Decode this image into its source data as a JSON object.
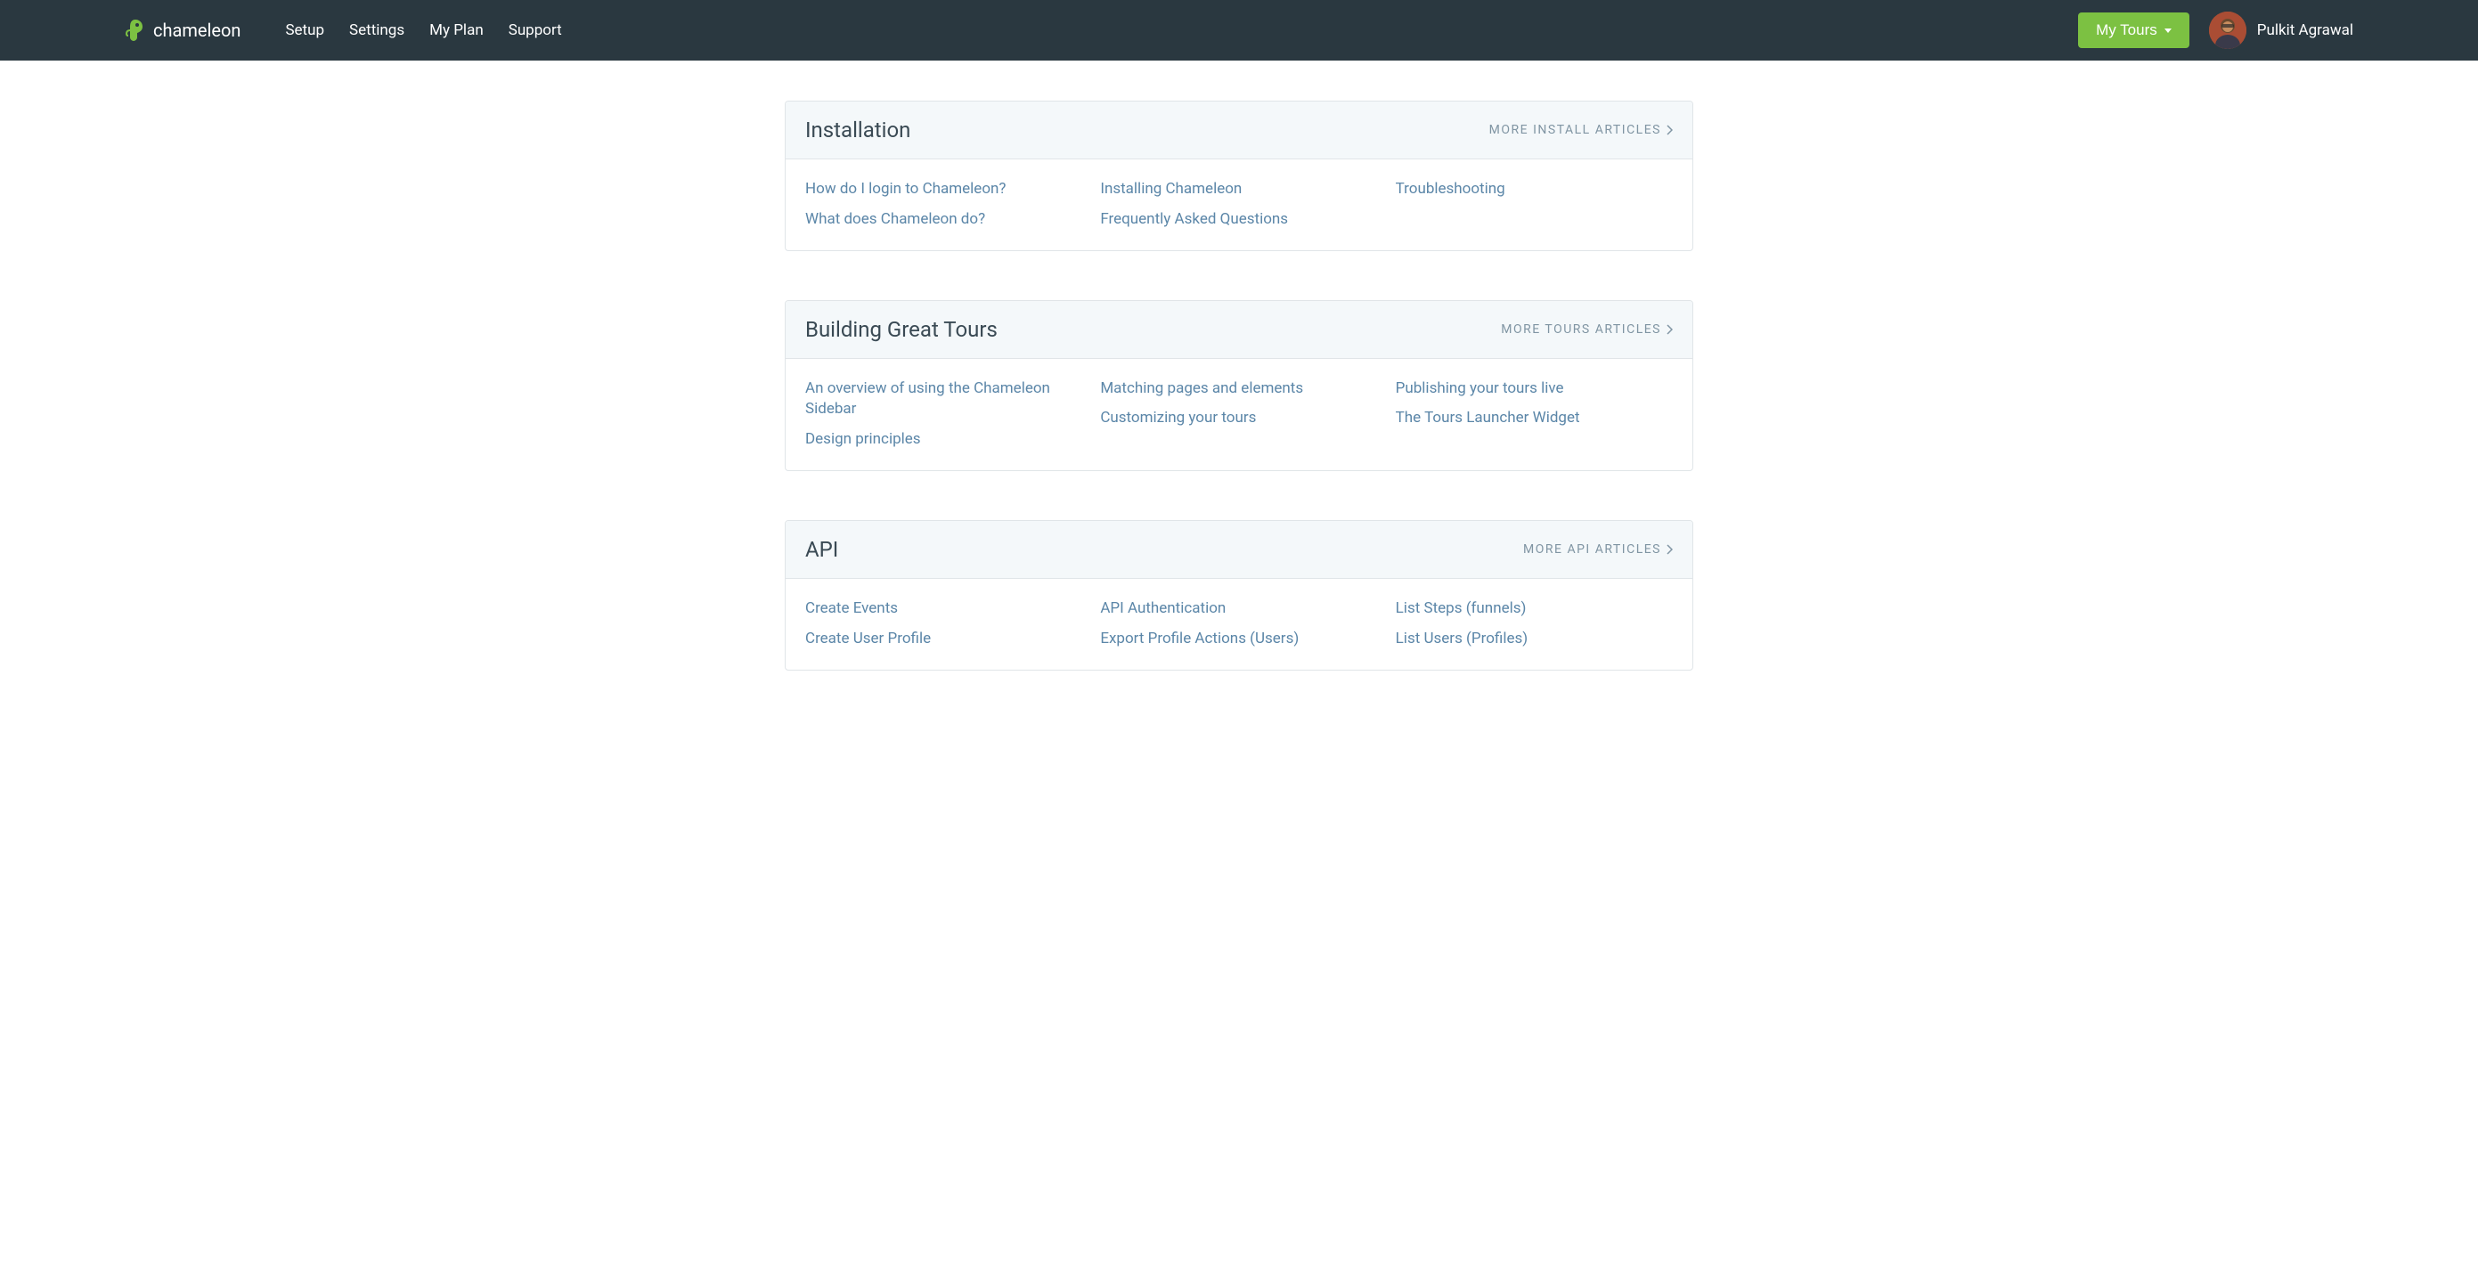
{
  "nav": {
    "brand": "chameleon",
    "links": [
      "Setup",
      "Settings",
      "My Plan",
      "Support"
    ],
    "my_tours_label": "My Tours",
    "user_name": "Pulkit Agrawal"
  },
  "sections": [
    {
      "title": "Installation",
      "more_label": "MORE INSTALL ARTICLES",
      "columns": [
        [
          "How do I login to Chameleon?",
          "What does Chameleon do?"
        ],
        [
          "Installing Chameleon",
          "Frequently Asked Questions"
        ],
        [
          "Troubleshooting"
        ]
      ]
    },
    {
      "title": "Building Great Tours",
      "more_label": "MORE TOURS ARTICLES",
      "columns": [
        [
          "An overview of using the Chameleon Sidebar",
          "Design principles"
        ],
        [
          "Matching pages and elements",
          "Customizing your tours"
        ],
        [
          "Publishing your tours live",
          "The Tours Launcher Widget"
        ]
      ]
    },
    {
      "title": "API",
      "more_label": "MORE API ARTICLES",
      "columns": [
        [
          "Create Events",
          "Create User Profile"
        ],
        [
          "API Authentication",
          "Export Profile Actions (Users)"
        ],
        [
          "List Steps (funnels)",
          "List Users (Profiles)"
        ]
      ]
    }
  ]
}
